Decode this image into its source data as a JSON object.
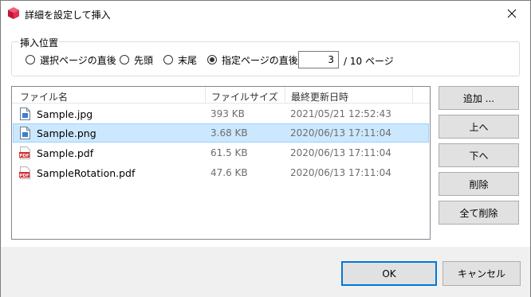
{
  "window": {
    "title": "詳細を設定して挿入"
  },
  "position_group": {
    "legend": "挿入位置",
    "options": [
      {
        "label": "選択ページの直後",
        "checked": false
      },
      {
        "label": "先頭",
        "checked": false
      },
      {
        "label": "末尾",
        "checked": false
      },
      {
        "label": "指定ページの直後",
        "checked": true
      }
    ],
    "page_value": "3",
    "page_total": "/ 10 ページ"
  },
  "file_list": {
    "columns": [
      "ファイル名",
      "ファイルサイズ",
      "最終更新日時"
    ],
    "rows": [
      {
        "name": "Sample.jpg",
        "size": "393 KB",
        "modified": "2021/05/21 12:52:43",
        "icon": "image-file-icon",
        "selected": false
      },
      {
        "name": "Sample.png",
        "size": "3.68 KB",
        "modified": "2020/06/13 17:11:04",
        "icon": "image-file-icon",
        "selected": true
      },
      {
        "name": "Sample.pdf",
        "size": "61.5 KB",
        "modified": "2020/06/13 17:11:04",
        "icon": "pdf-file-icon",
        "selected": false
      },
      {
        "name": "SampleRotation.pdf",
        "size": "47.6 KB",
        "modified": "2020/06/13 17:11:04",
        "icon": "pdf-file-icon",
        "selected": false
      }
    ]
  },
  "buttons": {
    "add": "追加 ...",
    "up": "上へ",
    "down": "下へ",
    "delete": "削除",
    "delete_all": "全て削除",
    "ok": "OK",
    "cancel": "キャンセル"
  },
  "colors": {
    "accent": "#0078d7",
    "selection": "#cce8ff",
    "pdf_red": "#d7262a"
  }
}
